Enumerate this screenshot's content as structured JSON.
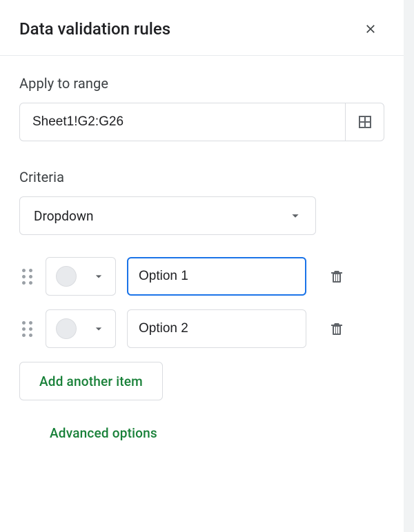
{
  "header": {
    "title": "Data validation rules"
  },
  "range": {
    "label": "Apply to range",
    "value": "Sheet1!G2:G26"
  },
  "criteria": {
    "label": "Criteria",
    "selected": "Dropdown"
  },
  "options": [
    {
      "value": "Option 1",
      "focused": true
    },
    {
      "value": "Option 2",
      "focused": false
    }
  ],
  "buttons": {
    "add_item": "Add another item",
    "advanced": "Advanced options"
  }
}
